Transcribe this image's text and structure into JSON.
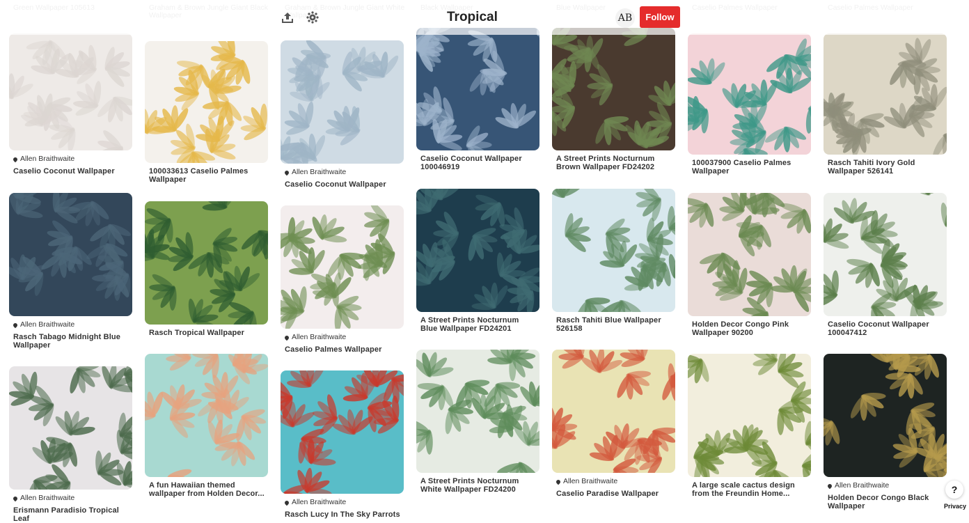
{
  "header": {
    "board_title": "Tropical",
    "avatar_initials": "AB",
    "follow_label": "Follow"
  },
  "ghost_titles": [
    "Green Wallpaper 105613",
    "Graham & Brown Jungle Giant Black Wallpaper",
    "Graham & Brown Jungle Giant White Wallpaper",
    "Black Wallpaper",
    "Blue Wallpaper",
    "Caselio Palmes Wallpaper",
    "Caselio Palmes Wallpaper"
  ],
  "columns": [
    [
      {
        "source": "Allen Braithwaite",
        "title": "Caselio Coconut Wallpaper",
        "colors": [
          "#eeeae7",
          "#dcd6d2"
        ]
      },
      {
        "source": "Allen Braithwaite",
        "title": "Rasch Tabago Midnight Blue Wallpaper",
        "colors": [
          "#33475a",
          "#4c6678"
        ]
      },
      {
        "source": "Allen Braithwaite",
        "title": "Erismann Paradisio Tropical Leaf",
        "colors": [
          "#e7e4e6",
          "#4d6b4d"
        ]
      }
    ],
    [
      {
        "source": "",
        "title": "100033613 Caselio Palmes Wallpaper",
        "colors": [
          "#f4f1ec",
          "#e5b84a"
        ]
      },
      {
        "source": "",
        "title": "Rasch Tropical Wallpaper",
        "colors": [
          "#7da04f",
          "#2f5d31"
        ]
      },
      {
        "source": "",
        "title": "A fun Hawaiian themed wallpaper from Holden Decor...",
        "colors": [
          "#a8d9d1",
          "#e6a37f"
        ]
      }
    ],
    [
      {
        "source": "Allen Braithwaite",
        "title": "Caselio Coconut Wallpaper",
        "colors": [
          "#cfdbe4",
          "#9fb5c6"
        ]
      },
      {
        "source": "Allen Braithwaite",
        "title": "Caselio Palmes Wallpaper",
        "colors": [
          "#f3eded",
          "#6e8e52"
        ]
      },
      {
        "source": "Allen Braithwaite",
        "title": "Rasch Lucy In The Sky Parrots",
        "colors": [
          "#59bdc8",
          "#c9392c"
        ]
      }
    ],
    [
      {
        "source": "",
        "title": "Caselio Coconut Wallpaper 100046919",
        "colors": [
          "#375576",
          "#9db3cb"
        ]
      },
      {
        "source": "",
        "title": "A Street Prints Nocturnum Blue Wallpaper FD24201",
        "colors": [
          "#1e3d4d",
          "#3f6b72"
        ]
      },
      {
        "source": "",
        "title": "A Street Prints Nocturnum White Wallpaper FD24200",
        "colors": [
          "#e6ebe3",
          "#5e8c5b"
        ]
      }
    ],
    [
      {
        "source": "",
        "title": "A Street Prints Nocturnum Brown Wallpaper FD24202",
        "colors": [
          "#4a3a2f",
          "#6f8752"
        ]
      },
      {
        "source": "",
        "title": "Rasch Tahiti Blue Wallpaper 526158",
        "colors": [
          "#d8e8ee",
          "#5f8a62"
        ]
      },
      {
        "source": "Allen Braithwaite",
        "title": "Caselio Paradise Wallpaper",
        "colors": [
          "#e9e3b4",
          "#d35a3e"
        ]
      }
    ],
    [
      {
        "source": "",
        "title": "100037900 Caselio Palmes Wallpaper",
        "colors": [
          "#f3d3d8",
          "#3e9888"
        ]
      },
      {
        "source": "",
        "title": "Holden Decor Congo Pink Wallpaper 90200",
        "colors": [
          "#eadcd8",
          "#6b8a52"
        ]
      },
      {
        "source": "",
        "title": "A large scale cactus design from the Freundin Home...",
        "colors": [
          "#f2eedd",
          "#6d8a37"
        ]
      }
    ],
    [
      {
        "source": "",
        "title": "Rasch Tahiti Ivory Gold Wallpaper 526141",
        "colors": [
          "#ddd7c6",
          "#8f8e7b"
        ]
      },
      {
        "source": "",
        "title": "Caselio Coconut Wallpaper 100047412",
        "colors": [
          "#eef0ec",
          "#5c7f4b"
        ]
      },
      {
        "source": "Allen Braithwaite",
        "title": "Holden Decor Congo Black Wallpaper",
        "colors": [
          "#1e2422",
          "#b59a4c"
        ]
      }
    ]
  ],
  "help_label": "?",
  "privacy_label": "Privacy"
}
